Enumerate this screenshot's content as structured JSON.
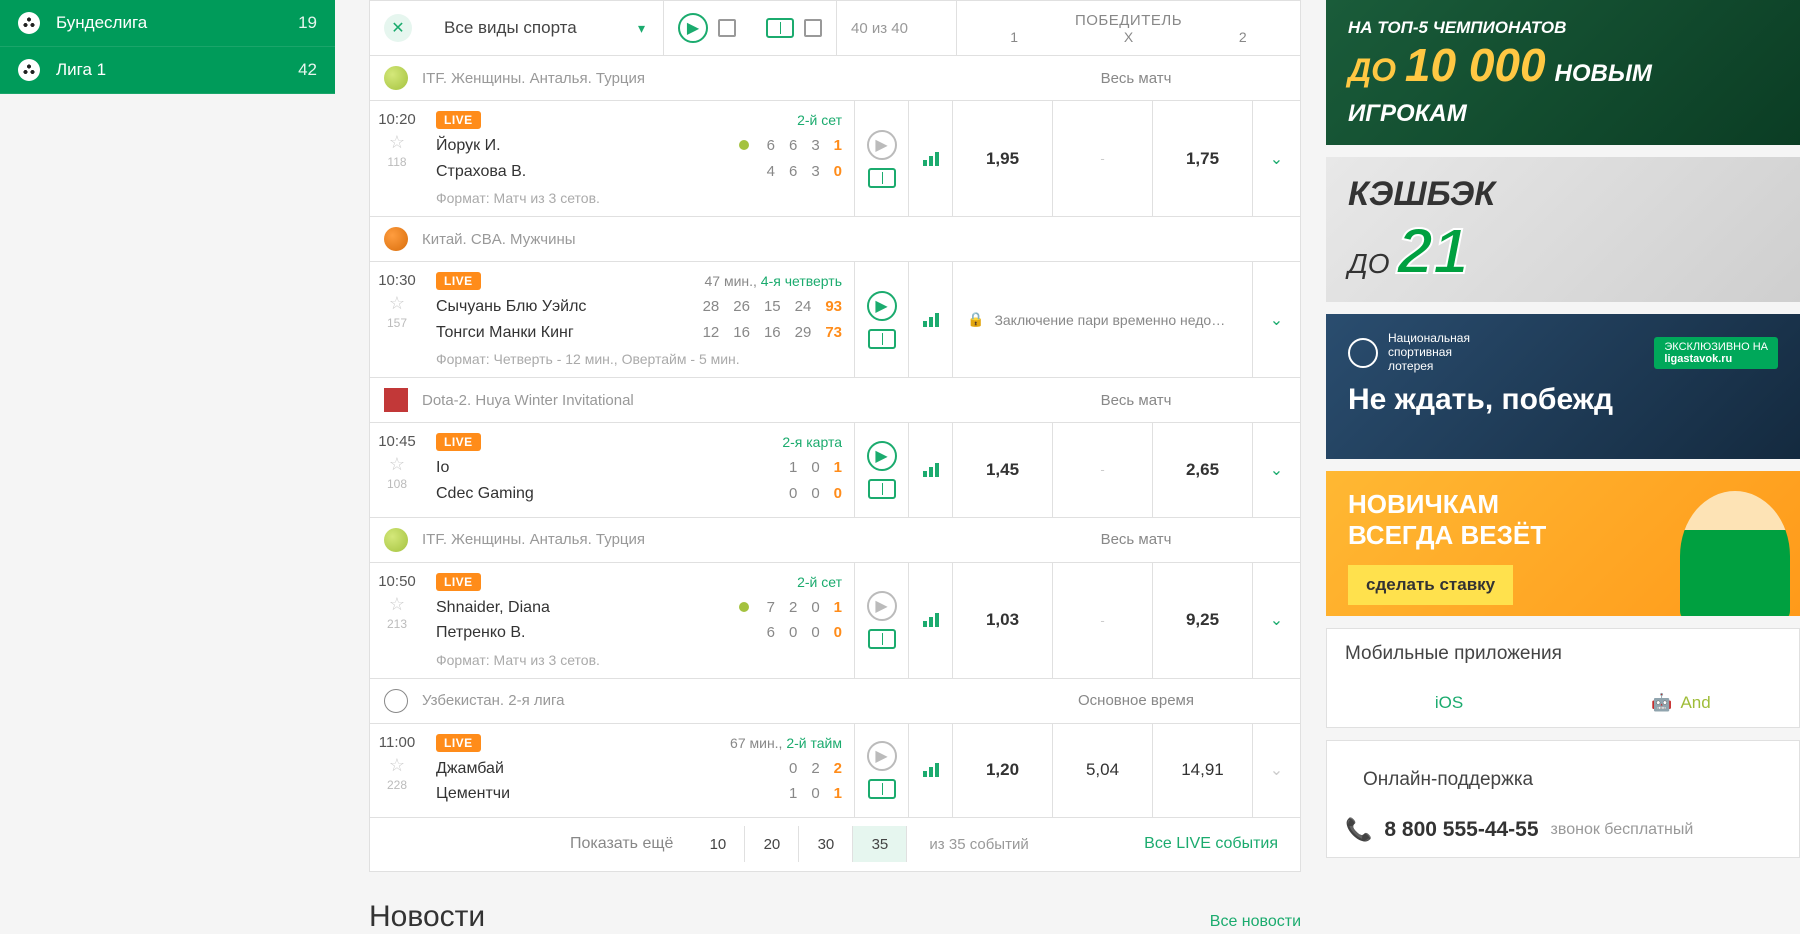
{
  "sidebar": {
    "items": [
      {
        "label": "Бундеслига",
        "count": "19"
      },
      {
        "label": "Лига 1",
        "count": "42"
      }
    ]
  },
  "filterBar": {
    "sportLabel": "Все виды спорта",
    "countLabel": "40 из 40",
    "winnerLabel": "ПОБЕДИТЕЛЬ",
    "col1": "1",
    "colX": "X",
    "col2": "2"
  },
  "leagues": [
    {
      "icon": "tennis",
      "name": "ITF. Женщины. Анталья. Турция",
      "market": "Весь матч",
      "event": {
        "time": "10:20",
        "count": "118",
        "live": "LIVE",
        "status": "2-й сет",
        "team1": "Йорук И.",
        "team2": "Страхова В.",
        "serve": 2,
        "scores": [
          [
            "6",
            "4"
          ],
          [
            "6",
            "6"
          ],
          [
            "3",
            "3"
          ],
          [
            "1",
            "0"
          ]
        ],
        "format": "Формат: Матч из 3 сетов.",
        "playState": "grey",
        "odds": {
          "o1": "1,95",
          "ox": "-",
          "o2": "1,75"
        },
        "expand": true
      }
    },
    {
      "icon": "basket",
      "name": "Китай. CBA. Мужчины",
      "market": "",
      "event": {
        "time": "10:30",
        "count": "157",
        "live": "LIVE",
        "statusGrey": "47 мин., ",
        "status": "4-я четверть",
        "team1": "Сычуань Блю Уэйлс",
        "team2": "Тонгси Манки Кинг",
        "scores": [
          [
            "28",
            "12"
          ],
          [
            "26",
            "16"
          ],
          [
            "15",
            "16"
          ],
          [
            "24",
            "29"
          ],
          [
            "93",
            "73"
          ]
        ],
        "format": "Формат: Четверть - 12 мин., Овертайм - 5 мин.",
        "playState": "green",
        "locked": "Заключение пари временно недо…",
        "expand": true
      }
    },
    {
      "icon": "dota",
      "name": "Dota-2. Huya Winter Invitational",
      "market": "Весь матч",
      "event": {
        "time": "10:45",
        "count": "108",
        "live": "LIVE",
        "status": "2-я карта",
        "team1": "Io",
        "team2": "Cdec Gaming",
        "scores": [
          [
            "1",
            "0"
          ],
          [
            "0",
            "0"
          ],
          [
            "1",
            "0"
          ]
        ],
        "format": "",
        "playState": "green",
        "odds": {
          "o1": "1,45",
          "ox": "-",
          "o2": "2,65"
        },
        "expand": true
      }
    },
    {
      "icon": "tennis",
      "name": "ITF. Женщины. Анталья. Турция",
      "market": "Весь матч",
      "event": {
        "time": "10:50",
        "count": "213",
        "live": "LIVE",
        "status": "2-й сет",
        "team1": "Shnaider, Diana",
        "team2": "Петренко В.",
        "serve": 2,
        "scores": [
          [
            "7",
            "6"
          ],
          [
            "2",
            "0"
          ],
          [
            "0",
            "0"
          ],
          [
            "1",
            "0"
          ]
        ],
        "format": "Формат: Матч из 3 сетов.",
        "playState": "grey",
        "odds": {
          "o1": "1,03",
          "ox": "-",
          "o2": "9,25"
        },
        "expand": true
      }
    },
    {
      "icon": "foot",
      "name": "Узбекистан. 2-я лига",
      "market": "Основное время",
      "event": {
        "time": "11:00",
        "count": "228",
        "live": "LIVE",
        "statusGrey": "67 мин., ",
        "status": "2-й тайм",
        "team1": "Джамбай",
        "team2": "Цементчи",
        "scores": [
          [
            "0",
            "1"
          ],
          [
            "2",
            "0"
          ],
          [
            "2",
            "1"
          ]
        ],
        "format": "",
        "playState": "grey",
        "odds": {
          "o1": "1,20",
          "ox": "5,04",
          "o2": "14,91"
        },
        "expand": false
      }
    }
  ],
  "showMore": {
    "label": "Показать ещё",
    "pages": [
      "10",
      "20",
      "30",
      "35"
    ],
    "activePage": "35",
    "total": "из 35 событий",
    "allLive": "Все LIVE события"
  },
  "newsTitle": "Новости",
  "allNews": "Все новости",
  "promos": {
    "p1": {
      "line1": "НА ТОП-5 ЧЕМПИОНАТОВ",
      "prefix": "ДО",
      "amount": "10 000",
      "suffix1": "НОВЫМ",
      "suffix2": "ИГРОКАМ"
    },
    "p2": {
      "line1": "КЭШБЭК",
      "line2pre": "ДО",
      "line2big": "21"
    },
    "p3": {
      "lotName": "Национальная\nспортивная\nлотерея",
      "tag1": "ЭКСКЛЮЗИВНО НА",
      "tag2": "ligastavok.ru",
      "line2": "Не ждать, побежд"
    },
    "p4": {
      "line1": "НОВИЧКАМ",
      "line2": "ВСЕГДА ВЕЗЁТ",
      "btn": "сделать ставку"
    }
  },
  "mobile": {
    "title": "Мобильные приложения",
    "ios": "iOS",
    "android": "And"
  },
  "support": {
    "title": "Онлайн-поддержка",
    "phone": "8 800 555-44-55",
    "phoneNote": "звонок бесплатный"
  }
}
